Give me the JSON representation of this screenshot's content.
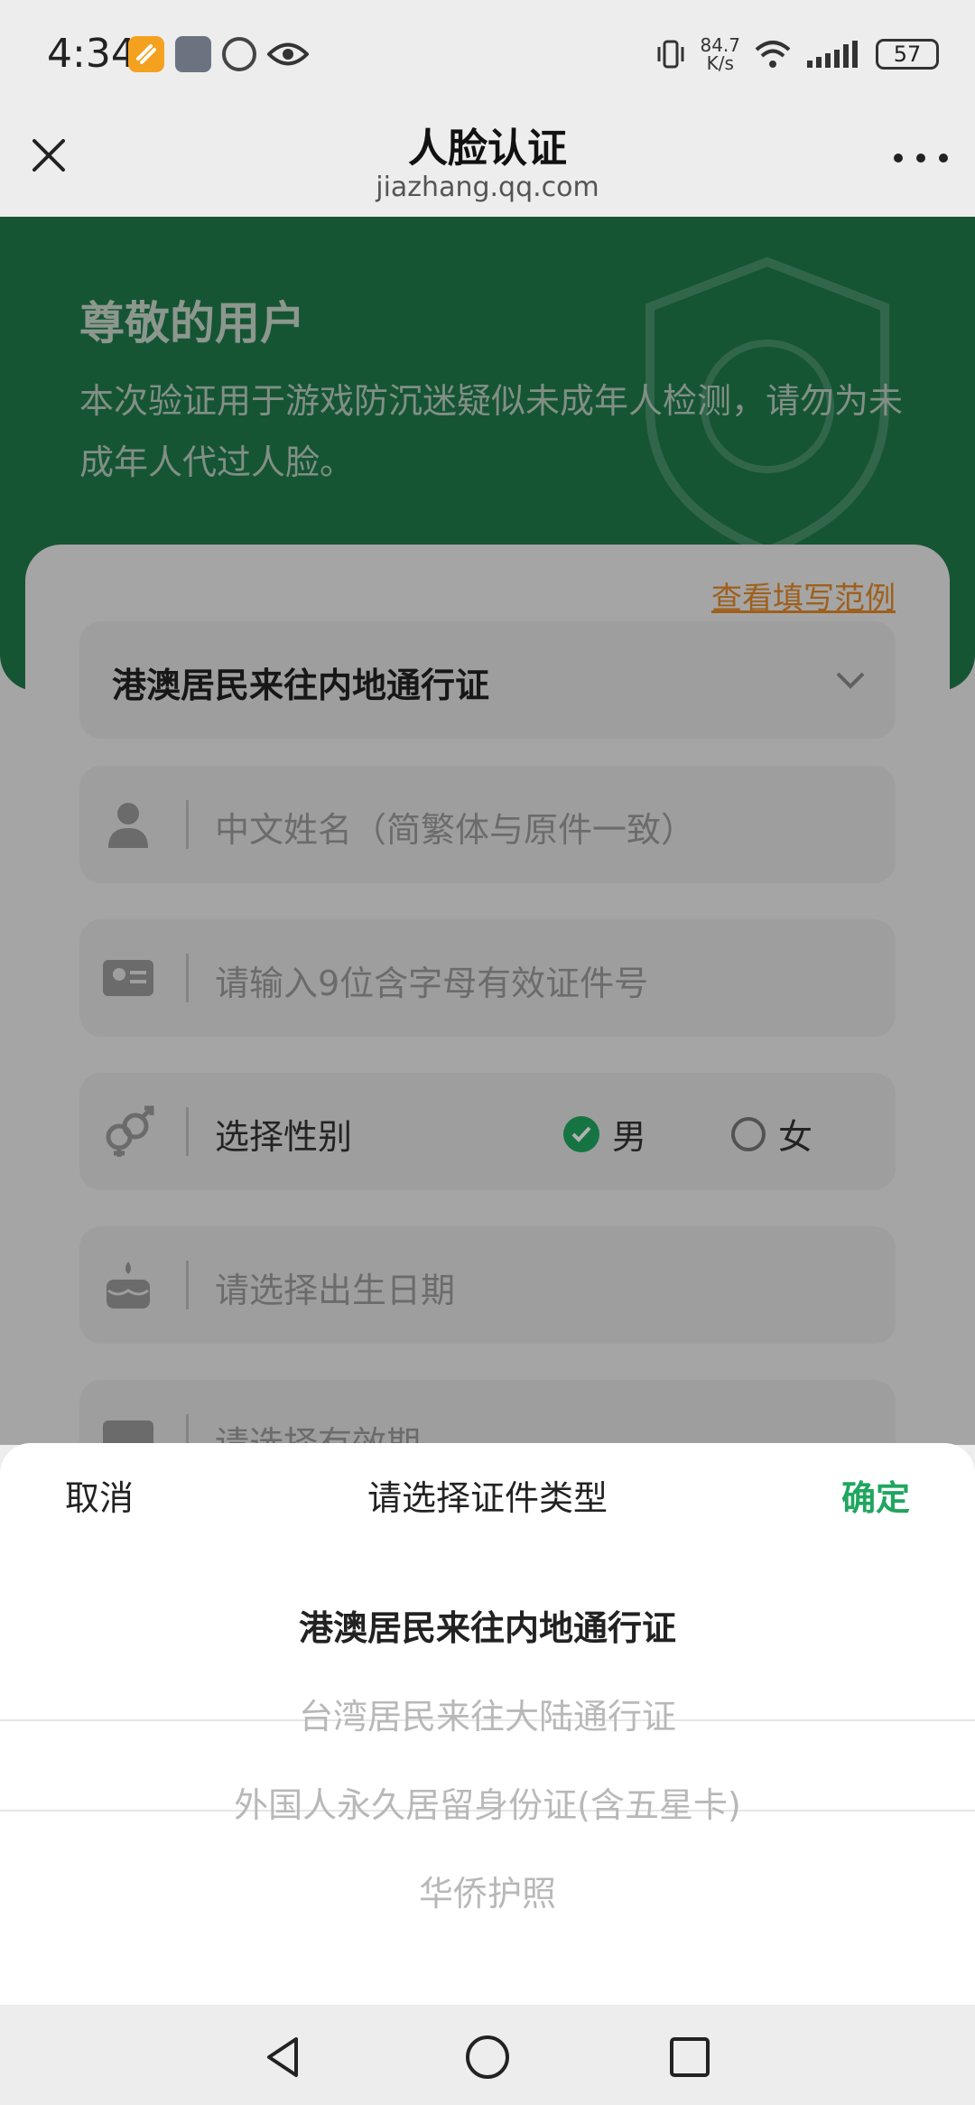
{
  "status": {
    "time": "4:34",
    "net_speed_value": "84.7",
    "net_speed_unit": "K/s",
    "battery": "57",
    "icons": [
      "app-icon",
      "game-avatar-icon",
      "sync-icon",
      "eye-icon",
      "vibrate-icon",
      "wifi-icon",
      "signal-icon",
      "battery-icon"
    ]
  },
  "header": {
    "title": "人脸认证",
    "subtitle": "jiazhang.qq.com",
    "close_icon": "close-icon",
    "more_icon": "more-icon"
  },
  "hero": {
    "title": "尊敬的用户",
    "text": "本次验证用于游戏防沉迷疑似未成年人检测，请勿为未成年人代过人脸。"
  },
  "form": {
    "example_link": "查看填写范例",
    "id_type_value": "港澳居民来往内地通行证",
    "name_placeholder": "中文姓名（简繁体与原件一致）",
    "id_number_placeholder": "请输入9位含字母有效证件号",
    "gender_label": "选择性别",
    "gender_male": "男",
    "gender_female": "女",
    "gender_selected": "男",
    "birth_placeholder": "请选择出生日期",
    "validity_placeholder": "请选择有效期"
  },
  "sheet": {
    "cancel": "取消",
    "title": "请选择证件类型",
    "confirm": "确定",
    "options": [
      "港澳居民来往内地通行证",
      "台湾居民来往大陆通行证",
      "外国人永久居留身份证(含五星卡)",
      "华侨护照"
    ],
    "selected_index": 0
  },
  "colors": {
    "accent_green": "#1fa65f",
    "hero_green": "#1f7a4b",
    "link_orange": "#e28a2a"
  }
}
